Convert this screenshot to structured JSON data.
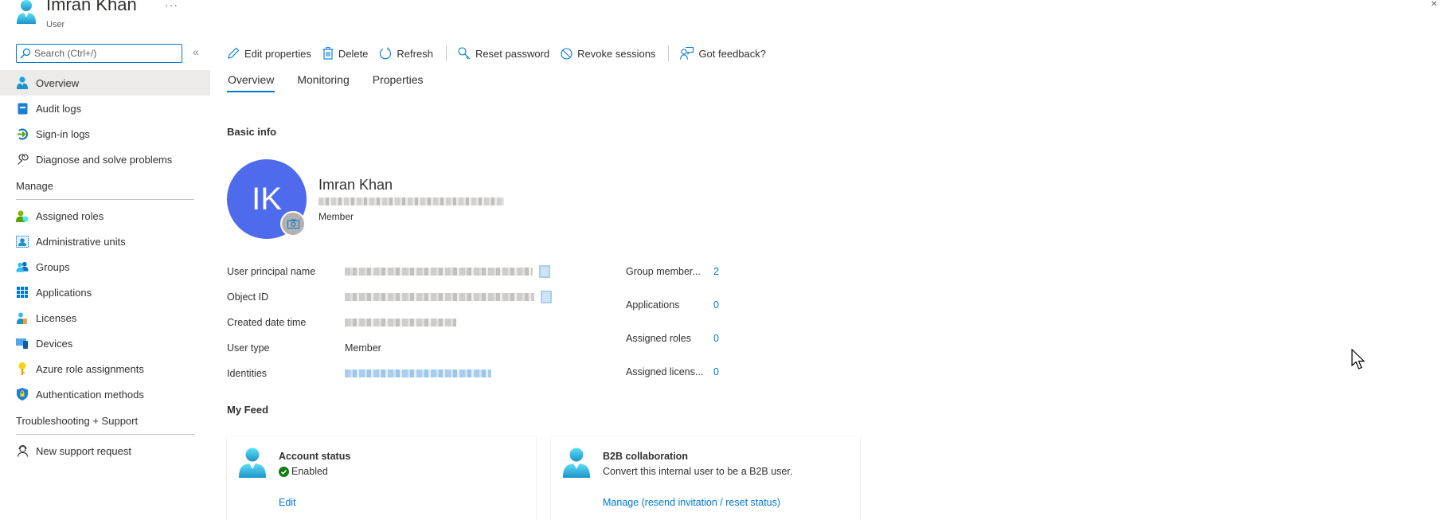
{
  "header": {
    "title": "Imran Khan",
    "subtitle": "User",
    "more_label": "···",
    "close_label": "×"
  },
  "sidebar": {
    "search_placeholder": "Search (Ctrl+/)",
    "collapse_label": "«",
    "items": [
      {
        "label": "Overview",
        "icon": "user-icon",
        "active": true
      },
      {
        "label": "Audit logs",
        "icon": "audit-log-icon"
      },
      {
        "label": "Sign-in logs",
        "icon": "sign-in-icon"
      },
      {
        "label": "Diagnose and solve problems",
        "icon": "wrench-icon"
      }
    ],
    "manage_title": "Manage",
    "manage_items": [
      {
        "label": "Assigned roles",
        "icon": "assigned-roles-icon"
      },
      {
        "label": "Administrative units",
        "icon": "admin-units-icon"
      },
      {
        "label": "Groups",
        "icon": "groups-icon"
      },
      {
        "label": "Applications",
        "icon": "applications-grid-icon"
      },
      {
        "label": "Licenses",
        "icon": "licenses-icon"
      },
      {
        "label": "Devices",
        "icon": "devices-icon"
      },
      {
        "label": "Azure role assignments",
        "icon": "key-icon"
      },
      {
        "label": "Authentication methods",
        "icon": "shield-lock-icon"
      }
    ],
    "support_title": "Troubleshooting + Support",
    "support_items": [
      {
        "label": "New support request",
        "icon": "support-person-icon"
      }
    ]
  },
  "toolbar": {
    "edit": "Edit properties",
    "delete": "Delete",
    "refresh": "Refresh",
    "reset_password": "Reset password",
    "revoke": "Revoke sessions",
    "feedback": "Got feedback?"
  },
  "tabs": [
    {
      "label": "Overview",
      "active": true
    },
    {
      "label": "Monitoring"
    },
    {
      "label": "Properties"
    }
  ],
  "basic_info": {
    "title": "Basic info",
    "initials": "IK",
    "name": "Imran Khan",
    "role": "Member",
    "properties": [
      {
        "label": "User principal name",
        "value": "[redacted]"
      },
      {
        "label": "Object ID",
        "value": "[redacted]"
      },
      {
        "label": "Created date time",
        "value": "[redacted]"
      },
      {
        "label": "User type",
        "value": "Member"
      },
      {
        "label": "Identities",
        "value": "[redacted]"
      }
    ],
    "stats": [
      {
        "label": "Group member...",
        "value": "2"
      },
      {
        "label": "Applications",
        "value": "0"
      },
      {
        "label": "Assigned roles",
        "value": "0"
      },
      {
        "label": "Assigned licens...",
        "value": "0"
      }
    ]
  },
  "feed": {
    "title": "My Feed",
    "cards": [
      {
        "title": "Account status",
        "status": "Enabled",
        "link": "Edit"
      },
      {
        "title": "B2B collaboration",
        "description": "Convert this internal user to be a B2B user.",
        "link": "Manage (resend invitation / reset status)"
      }
    ]
  },
  "colors": {
    "accent": "#0078d4",
    "avatar": "#4f6bed",
    "success": "#107c10"
  }
}
